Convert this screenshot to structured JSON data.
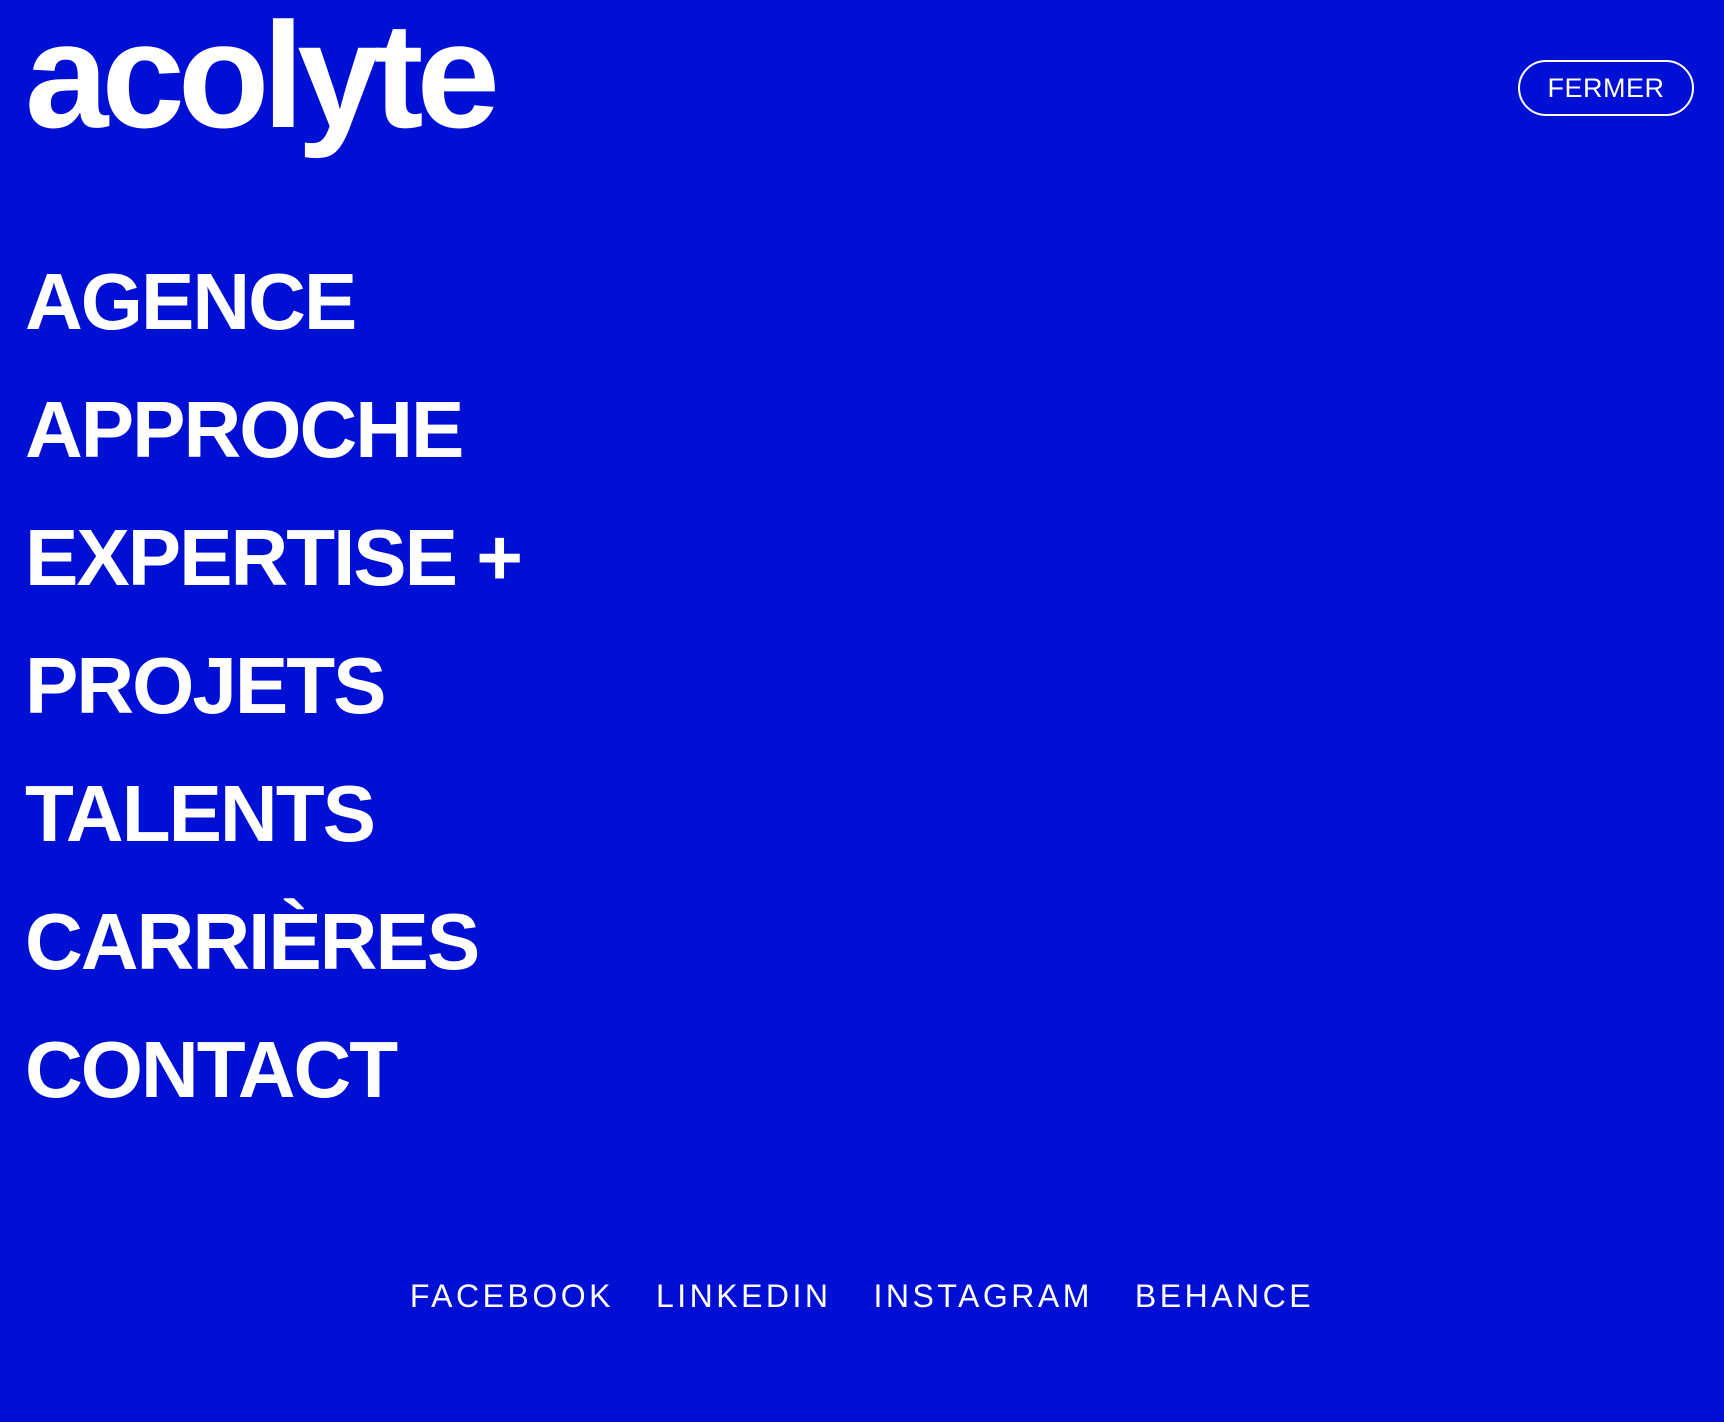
{
  "header": {
    "logo_text": "acolyte",
    "close_label": "FERMER"
  },
  "main_nav": {
    "items": [
      {
        "label": "AGENCE"
      },
      {
        "label": "APPROCHE"
      },
      {
        "label": "EXPERTISE +"
      },
      {
        "label": "PROJETS"
      },
      {
        "label": "TALENTS"
      },
      {
        "label": "CARRIÈRES"
      },
      {
        "label": "CONTACT"
      }
    ]
  },
  "social": {
    "items": [
      {
        "label": "FACEBOOK"
      },
      {
        "label": "LINKEDIN"
      },
      {
        "label": "INSTAGRAM"
      },
      {
        "label": "BEHANCE"
      }
    ]
  },
  "colors": {
    "background": "#000FD4",
    "foreground": "#FFFFFF"
  }
}
